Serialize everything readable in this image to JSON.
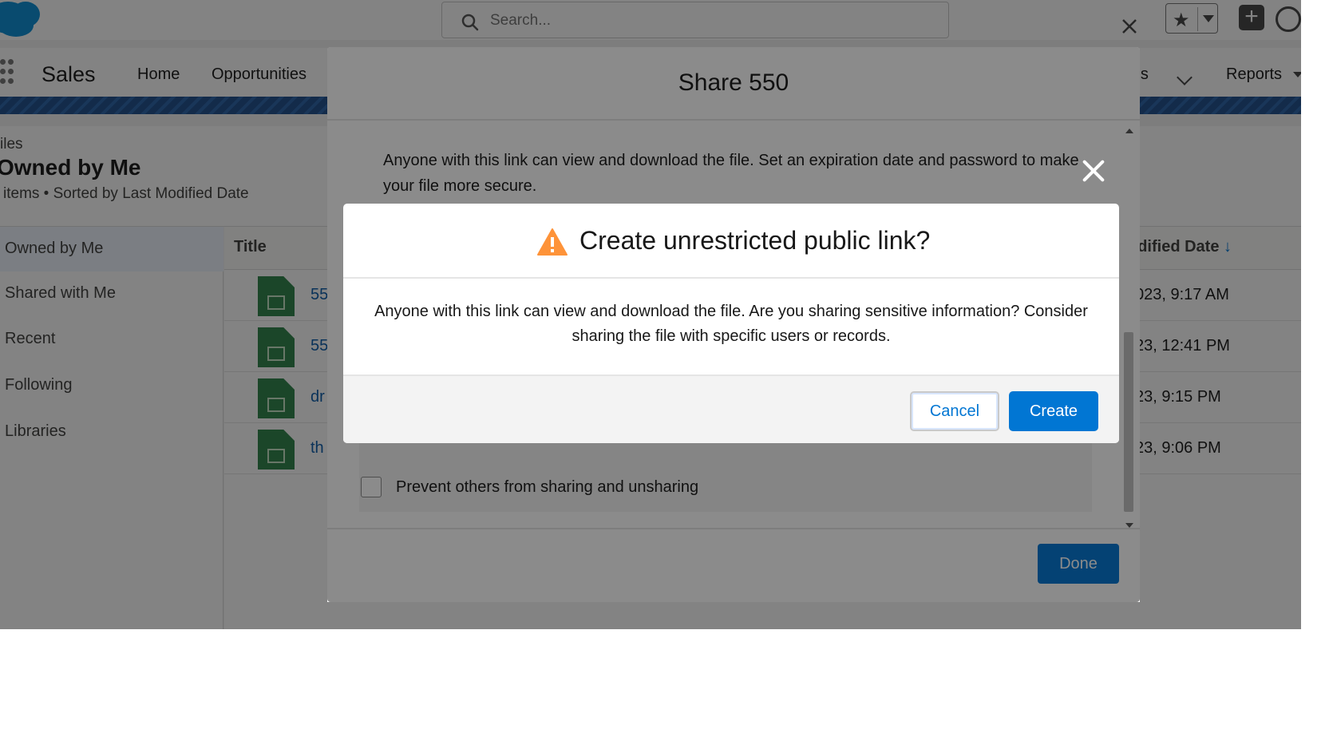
{
  "header": {
    "search_placeholder": "Search...",
    "logo_icon": "salesforce-cloud-icon"
  },
  "nav": {
    "app_name": "Sales",
    "items": [
      {
        "label": "Home"
      },
      {
        "label": "Opportunities"
      },
      {
        "label": "ards"
      },
      {
        "label": "Reports"
      }
    ]
  },
  "page": {
    "breadcrumb": "iles",
    "title": "Owned by Me",
    "meta": "items • Sorted by Last Modified Date"
  },
  "sidebar": {
    "items": [
      {
        "label": "Owned by Me"
      },
      {
        "label": "Shared with Me"
      },
      {
        "label": "Recent"
      },
      {
        "label": "Following"
      },
      {
        "label": "Libraries"
      }
    ]
  },
  "table": {
    "col_title": "Title",
    "col_date": "odified Date",
    "rows": [
      {
        "title": "55",
        "date": "023, 9:17 AM"
      },
      {
        "title": "55",
        "date": "23, 12:41 PM"
      },
      {
        "title": "dr",
        "date": "23, 9:15 PM"
      },
      {
        "title": "th",
        "date": "23, 9:06 PM"
      }
    ]
  },
  "share_modal": {
    "title": "Share 550",
    "description": "Anyone with this link can view and download the file. Set an expiration date and password to make your file more secure.",
    "prevent_sharing_label": "Prevent others from sharing and unsharing",
    "done_label": "Done"
  },
  "confirm_dialog": {
    "title": "Create unrestricted public link?",
    "message": "Anyone with this link can view and download the file. Are you sharing sensitive information? Consider sharing the file with specific users or records.",
    "cancel_label": "Cancel",
    "create_label": "Create",
    "warning_color": "#fe9339"
  },
  "colors": {
    "brand": "#0176d3",
    "file_green": "#2e844a",
    "link_blue": "#0b5cab"
  }
}
